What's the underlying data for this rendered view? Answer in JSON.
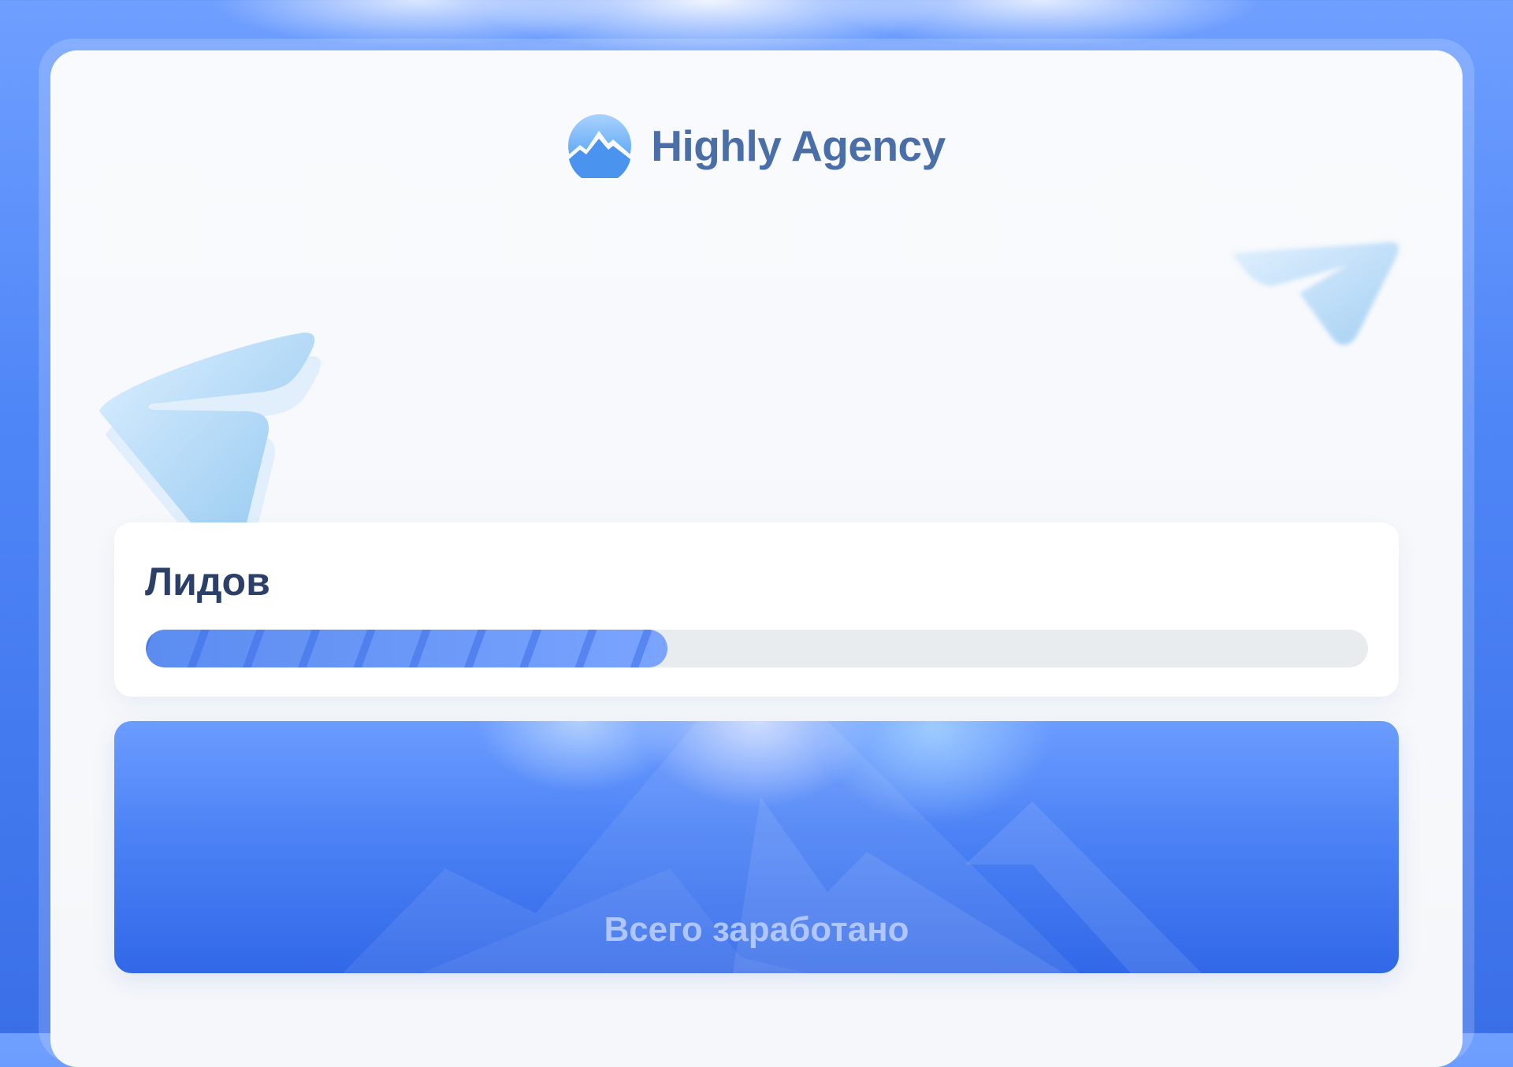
{
  "brand": {
    "name": "Highly Agency",
    "logo_icon": "mountain-logo-icon"
  },
  "leads": {
    "title": "Лидов",
    "progress_fraction": 0.427
  },
  "earnings": {
    "label": "Всего заработано"
  },
  "decor": {
    "left_icon": "paper-plane-icon",
    "right_icon": "paper-plane-icon"
  },
  "colors": {
    "brand_text": "#4a6fa8",
    "accent_blue": "#3168e8",
    "progress_start": "#5b8cf0",
    "progress_end": "#7aa4ff",
    "track": "#e8ecef",
    "title_text": "#2b3f68"
  }
}
